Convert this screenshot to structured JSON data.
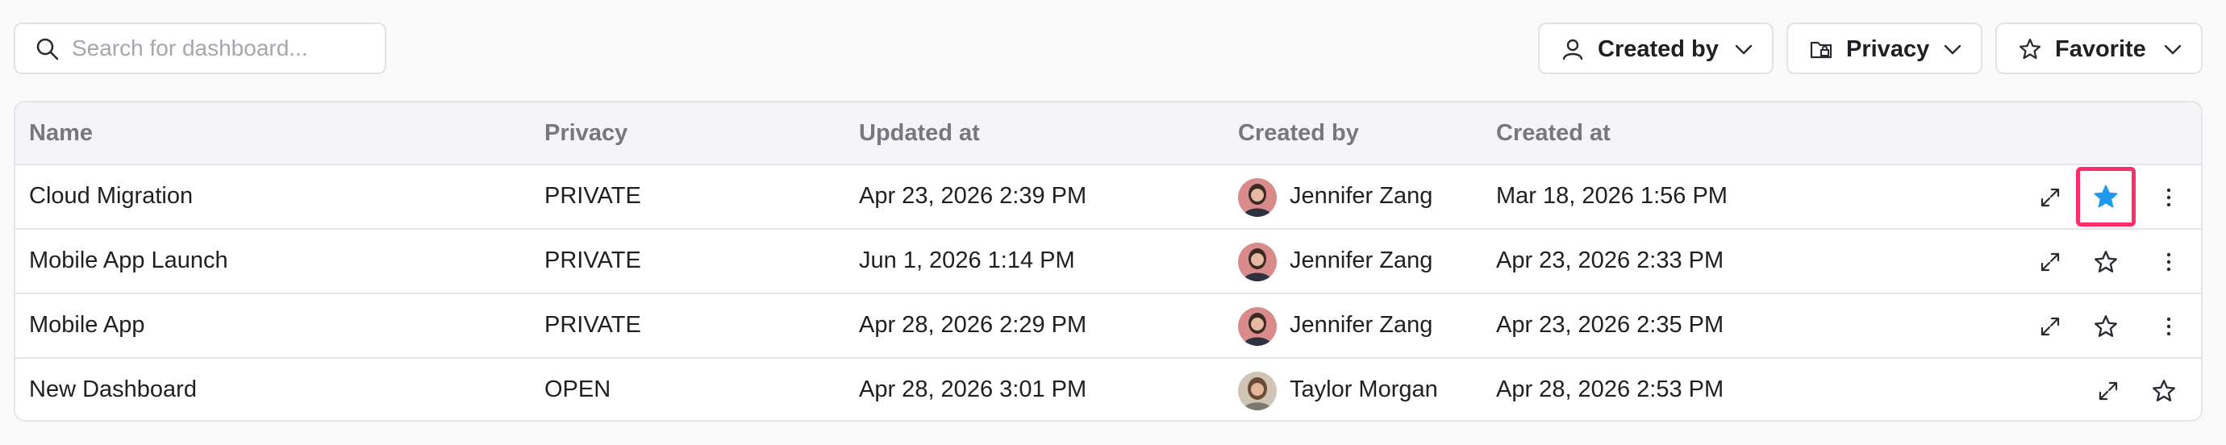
{
  "search": {
    "placeholder": "Search for dashboard..."
  },
  "filters": {
    "created_by": "Created by",
    "privacy": "Privacy",
    "favorite": "Favorite"
  },
  "table": {
    "headers": {
      "name": "Name",
      "privacy": "Privacy",
      "updated_at": "Updated at",
      "created_by": "Created by",
      "created_at": "Created at"
    },
    "rows": [
      {
        "name": "Cloud Migration",
        "privacy": "PRIVATE",
        "updated_at": "Apr 23, 2026 2:39 PM",
        "created_by": "Jennifer Zang",
        "created_at": "Mar 18, 2026 1:56 PM",
        "favorite": true
      },
      {
        "name": "Mobile App Launch",
        "privacy": "PRIVATE",
        "updated_at": "Jun 1, 2026 1:14 PM",
        "created_by": "Jennifer Zang",
        "created_at": "Apr 23, 2026 2:33 PM",
        "favorite": false
      },
      {
        "name": "Mobile App",
        "privacy": "PRIVATE",
        "updated_at": "Apr 28, 2026 2:29 PM",
        "created_by": "Jennifer Zang",
        "created_at": "Apr 23, 2026 2:35 PM",
        "favorite": false
      },
      {
        "name": "New Dashboard",
        "privacy": "OPEN",
        "updated_at": "Apr 28, 2026 3:01 PM",
        "created_by": "Taylor Morgan",
        "created_at": "Apr 28, 2026 2:53 PM",
        "favorite": false
      }
    ]
  },
  "icons": {
    "search": "search-icon",
    "user": "user-icon",
    "folder_lock": "folder-lock-icon",
    "star": "star-icon",
    "chevron": "chevron-down-icon",
    "expand": "expand-icon",
    "more": "more-vertical-icon"
  },
  "colors": {
    "favorite_active": "#1e9bf0",
    "highlight_border": "#ff2d6a",
    "header_text": "#77777f"
  }
}
